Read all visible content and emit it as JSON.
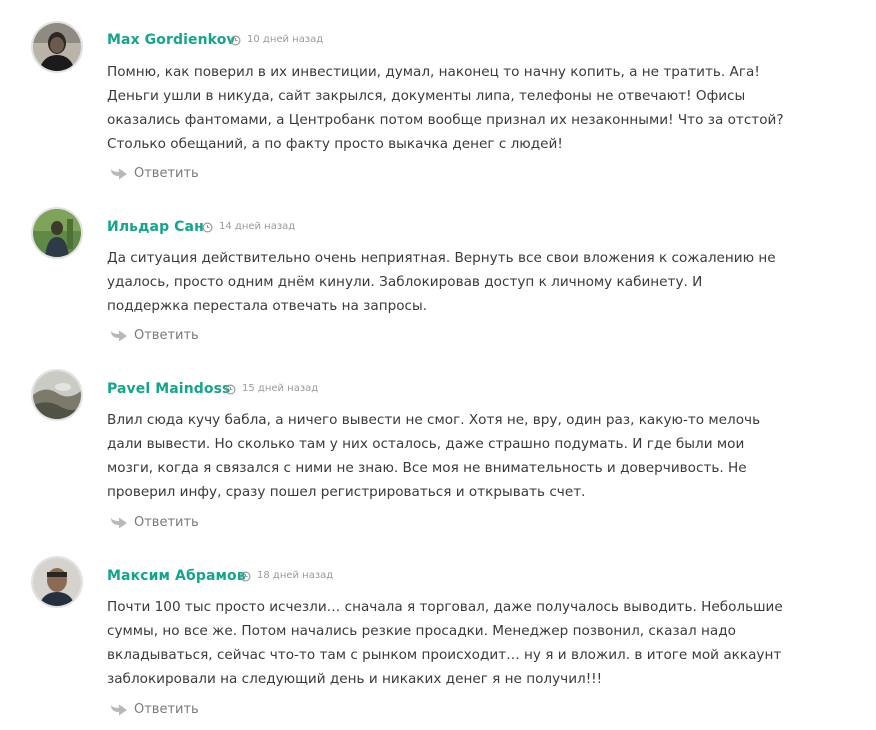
{
  "comments": [
    {
      "author": "Max Gordienkov",
      "time": "10 дней назад",
      "text": "Помню, как поверил в их инвестиции, думал, наконец то начну копить, а не тратить. Ага! Деньги ушли в никуда, сайт закрылся, документы липа, телефоны не отвечают! Офисы оказались фантомами, а Центробанк потом вообще признал их незаконными! Что за отстой? Столько обещаний, а по факту просто выкачка денег с людей!",
      "reply_label": "Ответить"
    },
    {
      "author": "Ильдар Сан",
      "time": "14 дней назад",
      "text": "Да ситуация действительно очень неприятная. Вернуть все свои вложения к сожалению не удалось, просто одним днём кинули. Заблокировав доступ к личному кабинету. И поддержка перестала отвечать на запросы.",
      "reply_label": "Ответить"
    },
    {
      "author": "Pavel Maindoss",
      "time": "15 дней назад",
      "text": "Влил сюда кучу бабла, а ничего вывести не смог. Хотя не, вру, один раз, какую-то мелочь дали вывести. Но сколько там у них осталось, даже страшно подумать. И где были мои мозги, когда я связался с ними не знаю. Все моя не внимательность и доверчивость. Не проверил инфу, сразу пошел регистрироваться и открывать счет.",
      "reply_label": "Ответить"
    },
    {
      "author": "Максим Абрамов",
      "time": "18 дней назад",
      "text": "Почти 100 тыс просто исчезли… сначала я торговал, даже получалось выводить. Небольшие суммы, но все же. Потом начались резкие просадки. Менеджер позвонил, сказал надо вкладываться, сейчас что-то там с рынком происходит… ну я и вложил. в итоге мой аккаунт заблокировали на следующий день и никаких денег я не получил!!!",
      "reply_label": "Ответить"
    }
  ],
  "colors": {
    "author": "#14a58a",
    "meta": "#9a9a9a",
    "text": "#3a3a3a",
    "reply": "#7a7a7a"
  },
  "icons": {
    "time": "clock-icon",
    "reply": "reply-arrow-icon"
  }
}
